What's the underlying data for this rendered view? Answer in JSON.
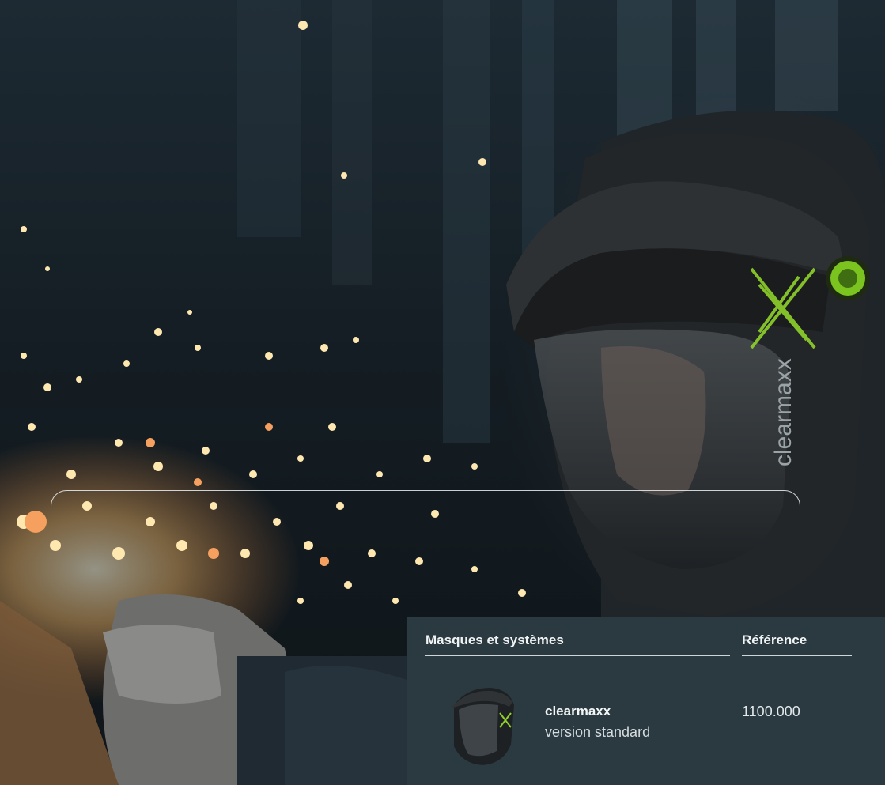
{
  "photo": {
    "brand_logo_text": "clearmaxx"
  },
  "table": {
    "headers": [
      "Masques et systèmes",
      "Référence"
    ],
    "rows": [
      {
        "name": "clearmaxx",
        "variant": "version standard",
        "reference": "1100.000"
      }
    ]
  },
  "colors": {
    "panel_bg": "#2b3a40",
    "accent_green": "#8fd12b",
    "text_light": "#e9eef0"
  }
}
